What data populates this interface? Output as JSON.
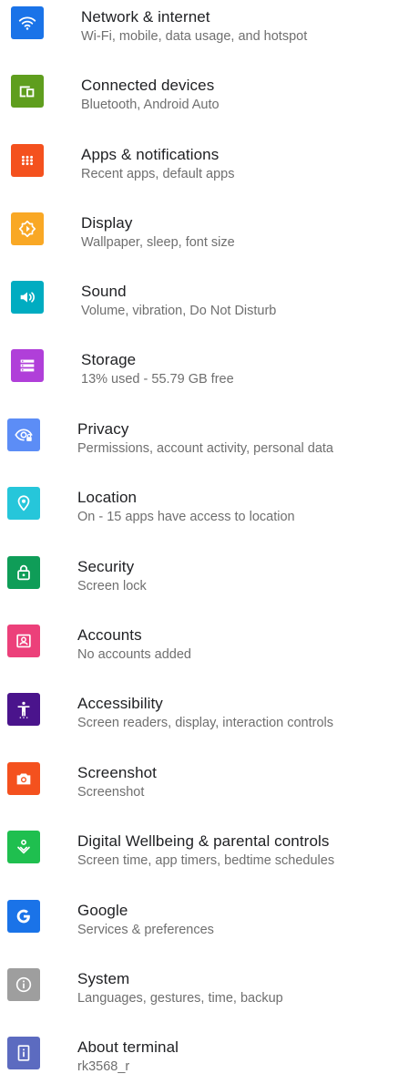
{
  "settings": {
    "items": [
      {
        "title": "Network & internet",
        "subtitle": "Wi-Fi, mobile, data usage, and hotspot",
        "icon": "wifi-icon",
        "color": "#1a73e8"
      },
      {
        "title": "Connected devices",
        "subtitle": "Bluetooth, Android Auto",
        "icon": "connected-devices-icon",
        "color": "#5f9e1e"
      },
      {
        "title": "Apps & notifications",
        "subtitle": "Recent apps, default apps",
        "icon": "apps-grid-icon",
        "color": "#f4511e"
      },
      {
        "title": "Display",
        "subtitle": "Wallpaper, sleep, font size",
        "icon": "display-brightness-icon",
        "color": "#f9a825"
      },
      {
        "title": "Sound",
        "subtitle": "Volume, vibration, Do Not Disturb",
        "icon": "volume-icon",
        "color": "#00acc1"
      },
      {
        "title": "Storage",
        "subtitle": "13% used - 55.79 GB free",
        "icon": "storage-icon",
        "color": "#b03fd9"
      },
      {
        "title": "Privacy",
        "subtitle": "Permissions, account activity, personal data",
        "icon": "privacy-eye-icon",
        "color": "#5c8df6"
      },
      {
        "title": "Location",
        "subtitle": "On - 15 apps have access to location",
        "icon": "location-pin-icon",
        "color": "#26c6da"
      },
      {
        "title": "Security",
        "subtitle": "Screen lock",
        "icon": "lock-icon",
        "color": "#0f9d58"
      },
      {
        "title": "Accounts",
        "subtitle": "No accounts added",
        "icon": "account-box-icon",
        "color": "#ec407a"
      },
      {
        "title": "Accessibility",
        "subtitle": "Screen readers, display, interaction controls",
        "icon": "accessibility-icon",
        "color": "#4a148c"
      },
      {
        "title": "Screenshot",
        "subtitle": "Screenshot",
        "icon": "camera-icon",
        "color": "#f4511e"
      },
      {
        "title": "Digital Wellbeing & parental controls",
        "subtitle": "Screen time, app timers, bedtime schedules",
        "icon": "wellbeing-icon",
        "color": "#1fbf4f"
      },
      {
        "title": "Google",
        "subtitle": "Services & preferences",
        "icon": "google-g-icon",
        "color": "#1a73e8"
      },
      {
        "title": "System",
        "subtitle": "Languages, gestures, time, backup",
        "icon": "info-icon",
        "color": "#9e9e9e"
      },
      {
        "title": "About terminal",
        "subtitle": "rk3568_r",
        "icon": "about-device-icon",
        "color": "#5c6bc0"
      }
    ]
  }
}
